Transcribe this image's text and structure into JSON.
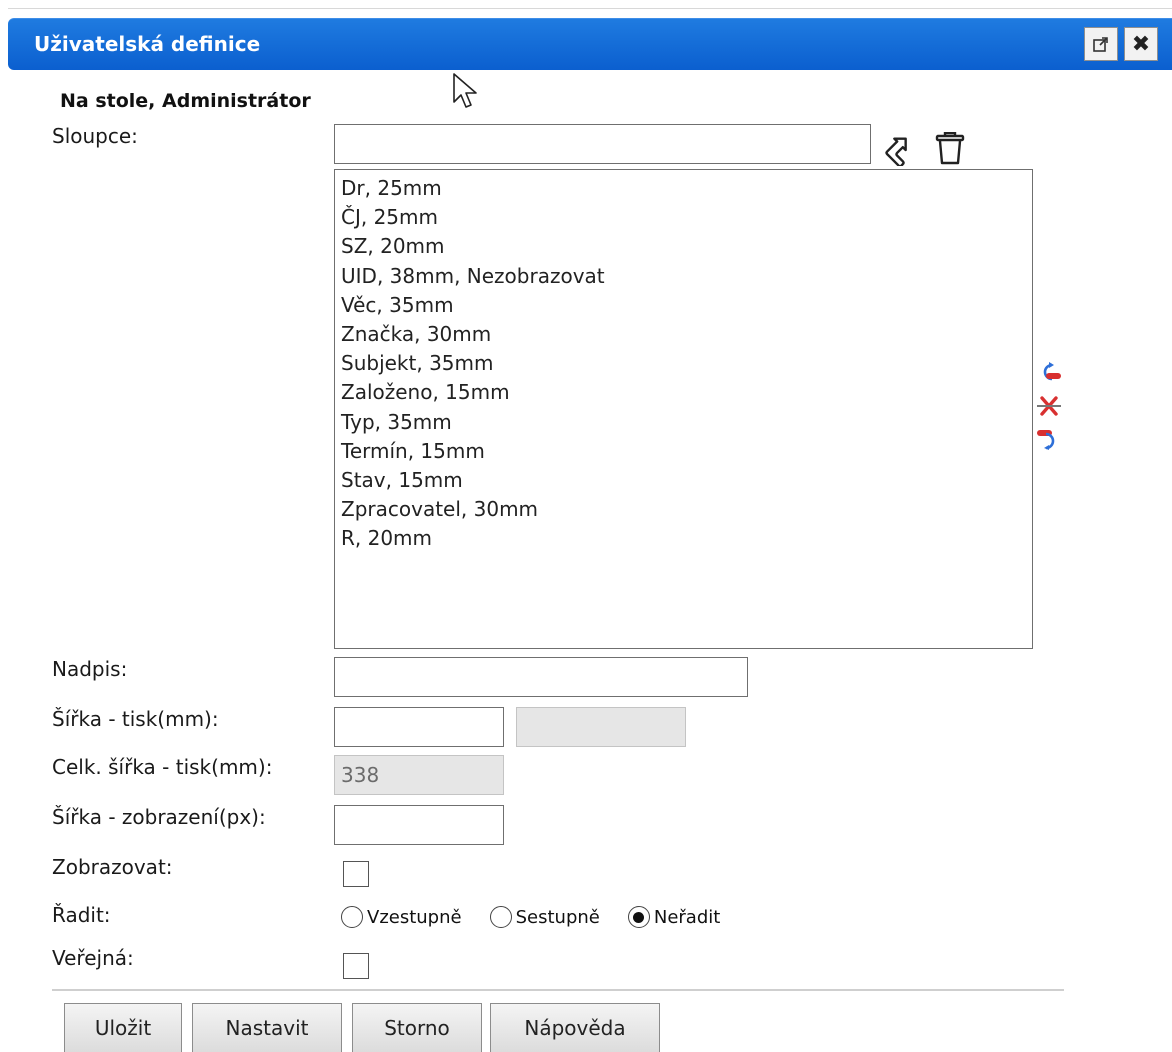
{
  "dialog": {
    "title": "Uživatelská definice",
    "subtitle": "Na stole,  Administrátor"
  },
  "labels": {
    "columns": "Sloupce:",
    "caption": "Nadpis:",
    "print_width": "Šířka - tisk(mm):",
    "total_print_width": "Celk. šířka - tisk(mm):",
    "display_width": "Šířka - zobrazení(px):",
    "show": "Zobrazovat:",
    "sort": "Řadit:",
    "public": "Veřejná:"
  },
  "fields": {
    "column_input": "",
    "caption": "",
    "print_width": "",
    "print_width_extra": "",
    "total_print_width": "338",
    "display_width": ""
  },
  "columns": [
    "Dr, 25mm",
    "ČJ, 25mm",
    "SZ, 20mm",
    "UID, 38mm, Nezobrazovat",
    "Věc, 35mm",
    "Značka, 30mm",
    "Subjekt, 35mm",
    "Založeno, 15mm",
    "Typ, 35mm",
    "Termín, 15mm",
    "Stav, 15mm",
    "Zpracovatel, 30mm",
    "R, 20mm"
  ],
  "sort_options": [
    {
      "label": "Vzestupně",
      "selected": false
    },
    {
      "label": "Sestupně",
      "selected": false
    },
    {
      "label": "Neřadit",
      "selected": true
    }
  ],
  "checkboxes": {
    "show": false,
    "public": false
  },
  "buttons": {
    "save": "Uložit",
    "set": "Nastavit",
    "cancel": "Storno",
    "help": "Nápověda"
  },
  "icons": {
    "popout": "popout-icon",
    "close": "close-icon",
    "apply": "arrow-apply-icon",
    "delete": "trash-icon",
    "move_up": "move-up-icon",
    "remove": "remove-icon",
    "move_down": "move-down-icon"
  },
  "colors": {
    "titlebar": "#0b5fcf",
    "accent_blue": "#2e6fd8",
    "accent_red": "#d83030"
  }
}
